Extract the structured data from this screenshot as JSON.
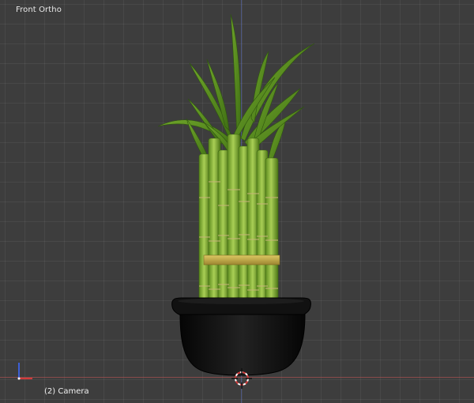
{
  "viewport": {
    "title": "Front Ortho",
    "status": "(2) Camera",
    "colors": {
      "background": "#3d3d3d",
      "axis_x": "#aa5050",
      "axis_z": "#5a6ebe",
      "pot": "#0e0e0e",
      "stalk_green": "#8cb536",
      "ribbon_gold": "#c9b04a"
    },
    "icons": [
      "axis-gizmo-icon",
      "3d-cursor-icon"
    ]
  }
}
